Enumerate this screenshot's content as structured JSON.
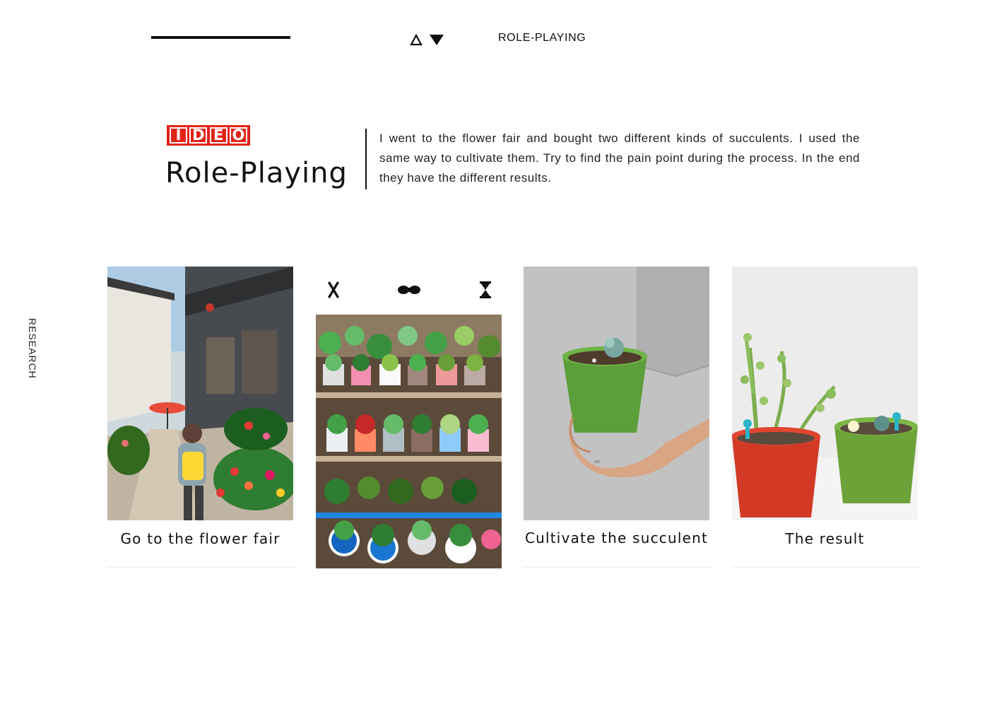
{
  "header": {
    "section_tag": "ROLE-PLAYING",
    "nav_icons": [
      "triangle-up-outline-icon",
      "triangle-down-filled-icon"
    ]
  },
  "logo": {
    "letters": [
      "I",
      "D",
      "E",
      "O"
    ],
    "color": "#e2231a"
  },
  "intro": {
    "title": "Role-Playing",
    "description": "I went to the flower fair and bought two different kinds of succulents. I used the same way to cultivate them. Try to find the pain point during the process. In the end they have the different results."
  },
  "sidebar": {
    "label": "RESEARCH"
  },
  "cards": [
    {
      "caption": "Go to the flower fair",
      "image": "street-flower-fair-photo"
    },
    {
      "caption": "",
      "image": "succulent-market-stall-photo",
      "icons": [
        "cross-icon",
        "infinity-icon",
        "hourglass-icon"
      ]
    },
    {
      "caption": "Cultivate the succulent",
      "image": "hand-holding-green-pot-photo"
    },
    {
      "caption": "The result",
      "image": "two-potted-succulents-photo"
    }
  ]
}
